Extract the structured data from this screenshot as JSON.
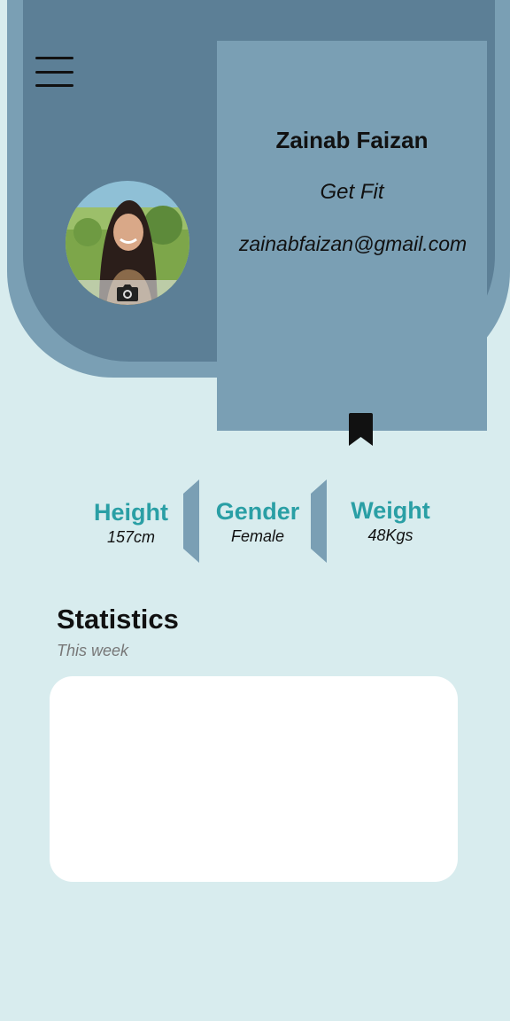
{
  "profile": {
    "name": "Zainab Faizan",
    "goal": "Get Fit",
    "email": "zainabfaizan@gmail.com"
  },
  "icons": {
    "menu": "hamburger-menu-icon",
    "camera": "camera-icon",
    "bookmark": "bookmark-icon"
  },
  "metrics": {
    "height": {
      "label": "Height",
      "value": "157cm"
    },
    "gender": {
      "label": "Gender",
      "value": "Female"
    },
    "weight": {
      "label": "Weight",
      "value": "48Kgs"
    }
  },
  "statistics": {
    "title": "Statistics",
    "subtitle": "This week"
  },
  "colors": {
    "background": "#d8ecee",
    "header_outer": "#7a9fb4",
    "header_inner": "#5c7f96",
    "accent": "#2a9fa5"
  }
}
